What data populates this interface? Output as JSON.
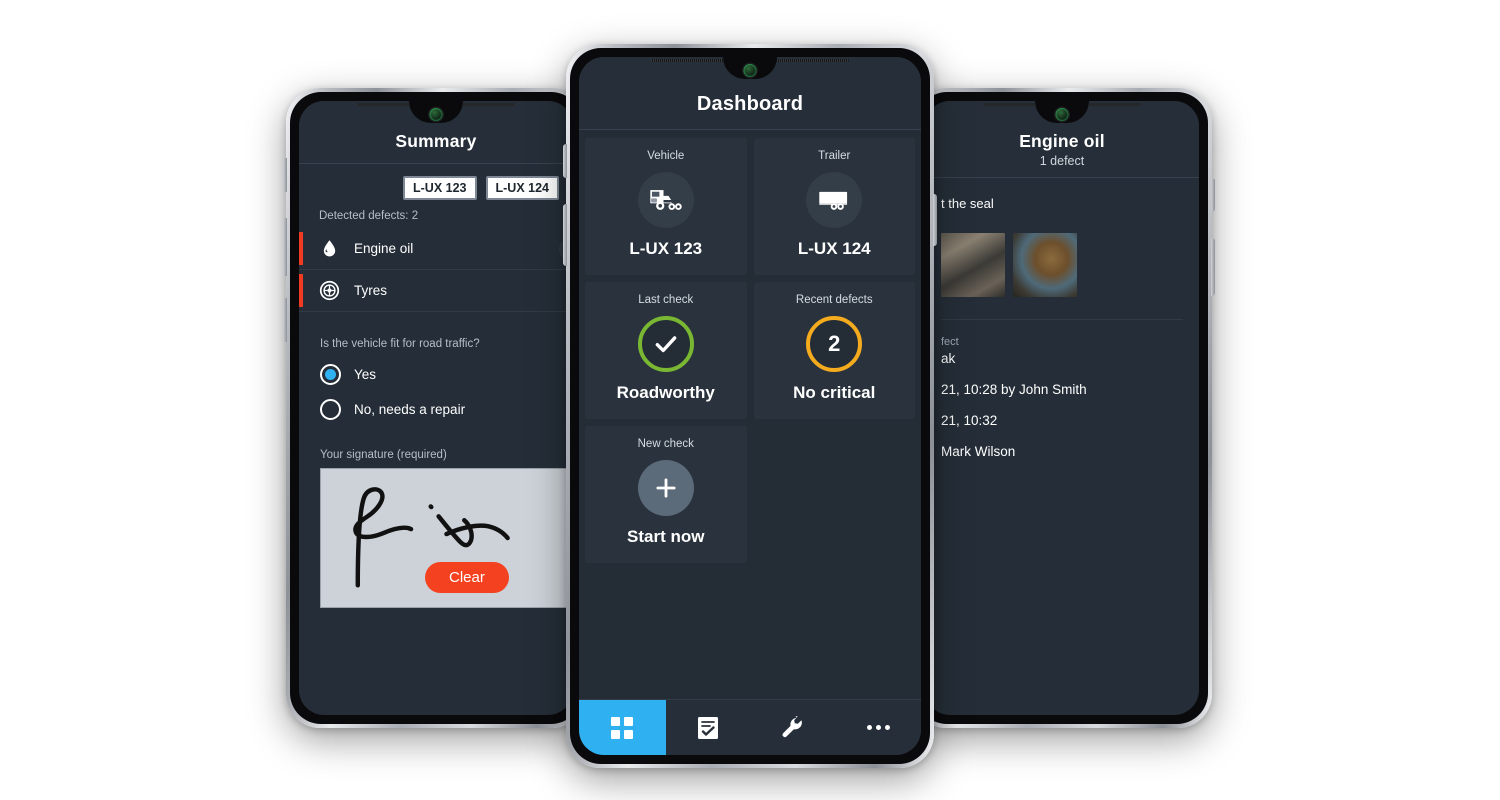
{
  "theme": {
    "bg": "#ffffff",
    "screen_bg": "#252e38",
    "card_bg": "#2a333d",
    "accent_blue": "#2fb0f0",
    "accent_green": "#7ab833",
    "accent_amber": "#f5ab1e",
    "accent_red": "#ef3b22",
    "clear_red": "#f4411f"
  },
  "left_phone": {
    "header": {
      "title": "Summary"
    },
    "chips": [
      {
        "label": "L-UX 123"
      },
      {
        "label": "L-UX 124"
      }
    ],
    "detected_defects_label": "Detected defects: 2",
    "defects": [
      {
        "name": "Engine oil",
        "icon": "oil-drop-icon",
        "severity_color": "#ef3b22"
      },
      {
        "name": "Tyres",
        "icon": "tyre-icon",
        "severity_color": "#ef3b22"
      }
    ],
    "question": "Is the vehicle fit for road traffic?",
    "options": [
      {
        "label": "Yes",
        "selected": true
      },
      {
        "label": "No, needs a repair",
        "selected": false
      }
    ],
    "signature_label": "Your signature (required)",
    "clear_button": "Clear"
  },
  "center_phone": {
    "header": {
      "title": "Dashboard"
    },
    "cards": [
      {
        "label": "Vehicle",
        "value": "L-UX 123",
        "icon": "truck-icon",
        "style": "dark-circle"
      },
      {
        "label": "Trailer",
        "value": "L-UX 124",
        "icon": "trailer-icon",
        "style": "dark-circle"
      },
      {
        "label": "Last check",
        "value": "Roadworthy",
        "icon": "check-icon",
        "style": "ring-green"
      },
      {
        "label": "Recent defects",
        "value": "No critical",
        "badge": "2",
        "icon": "count-badge",
        "style": "ring-amber"
      },
      {
        "label": "New check",
        "value": "Start now",
        "icon": "plus-icon",
        "style": "plus-circle"
      }
    ],
    "nav": [
      {
        "name": "dashboard",
        "icon": "grid-icon",
        "active": true
      },
      {
        "name": "checklist",
        "icon": "checklist-icon",
        "active": false
      },
      {
        "name": "maintenance",
        "icon": "wrench-icon",
        "active": false
      },
      {
        "name": "more",
        "icon": "more-dots-icon",
        "active": false
      }
    ]
  },
  "right_phone": {
    "header": {
      "title": "Engine oil",
      "subtitle": "1 defect"
    },
    "description": "t the seal",
    "photos_count": 2,
    "fields": [
      {
        "key": "fect",
        "value": "ak"
      },
      {
        "key": "",
        "value": "21, 10:28 by John Smith"
      },
      {
        "key": "",
        "value": "21, 10:32"
      },
      {
        "key": "",
        "value": "Mark Wilson"
      }
    ]
  }
}
